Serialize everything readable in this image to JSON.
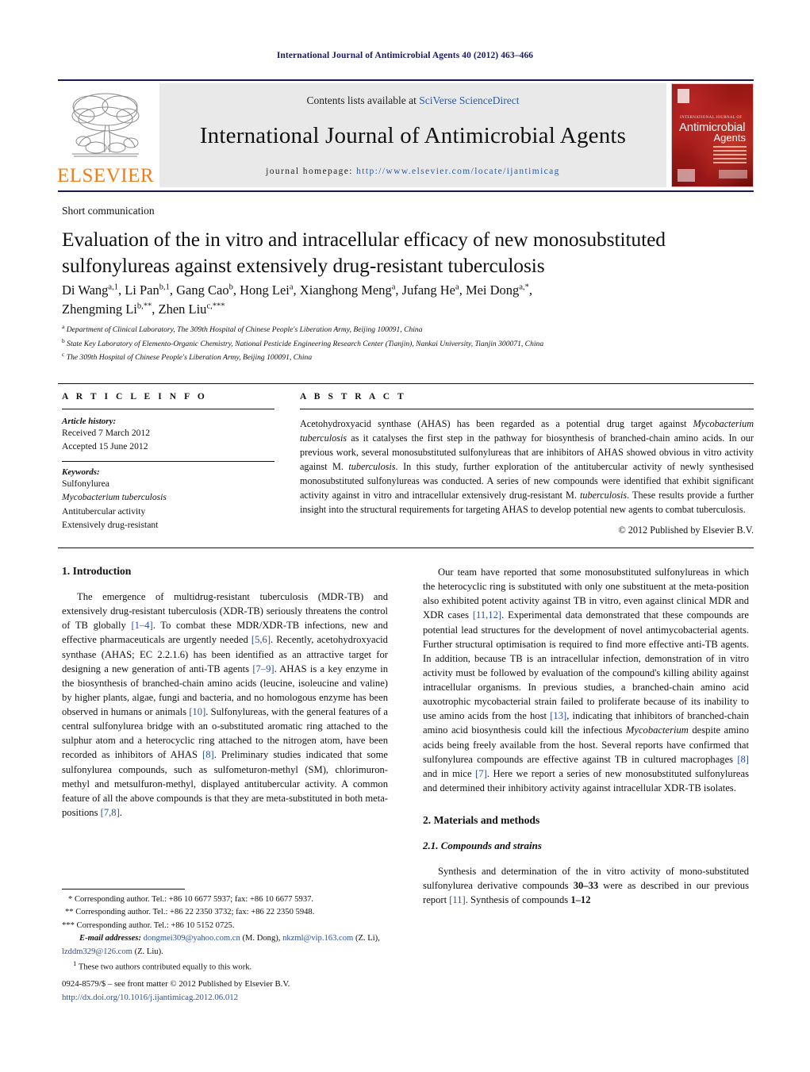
{
  "running_head": "International Journal of Antimicrobial Agents 40 (2012) 463–466",
  "masthead": {
    "publisher_logo_text": "ELSEVIER",
    "contents_prefix": "Contents lists available at ",
    "contents_link": "SciVerse ScienceDirect",
    "journal_title": "International Journal of Antimicrobial Agents",
    "homepage_prefix": "journal homepage: ",
    "homepage_url": "http://www.elsevier.com/locate/ijantimicag",
    "cover": {
      "kicker": "INTERNATIONAL JOURNAL OF",
      "title_line1": "Antimicrobial",
      "title_line2": "Agents"
    }
  },
  "article": {
    "type_label": "Short communication",
    "title": "Evaluation of the in vitro and intracellular efficacy of new monosubstituted sulfonylureas against extensively drug-resistant tuberculosis",
    "authors_line1": "Di Wang a,1, Li Pan b,1, Gang Cao b, Hong Lei a, Xianghong Meng a, Jufang He a, Mei Dong a,*,",
    "authors_line2": "Zhengming Li b,**, Zhen Liu c,***",
    "authors": [
      {
        "name": "Di Wang",
        "marks": "a,1"
      },
      {
        "name": "Li Pan",
        "marks": "b,1"
      },
      {
        "name": "Gang Cao",
        "marks": "b"
      },
      {
        "name": "Hong Lei",
        "marks": "a"
      },
      {
        "name": "Xianghong Meng",
        "marks": "a"
      },
      {
        "name": "Jufang He",
        "marks": "a"
      },
      {
        "name": "Mei Dong",
        "marks": "a,*"
      },
      {
        "name": "Zhengming Li",
        "marks": "b,**"
      },
      {
        "name": "Zhen Liu",
        "marks": "c,***"
      }
    ],
    "affiliations": [
      {
        "mark": "a",
        "text": "Department of Clinical Laboratory, The 309th Hospital of Chinese People's Liberation Army, Beijing 100091, China"
      },
      {
        "mark": "b",
        "text": "State Key Laboratory of Elemento-Organic Chemistry, National Pesticide Engineering Research Center (Tianjin), Nankai University, Tianjin 300071, China"
      },
      {
        "mark": "c",
        "text": "The 309th Hospital of Chinese People's Liberation Army, Beijing 100091, China"
      }
    ]
  },
  "article_info": {
    "heading": "A R T I C L E     I N F O",
    "history_label": "Article history:",
    "received": "Received 7 March 2012",
    "accepted": "Accepted 15 June 2012",
    "keywords_label": "Keywords:",
    "keywords": [
      "Sulfonylurea",
      "Mycobacterium tuberculosis",
      "Antitubercular activity",
      "Extensively drug-resistant"
    ]
  },
  "abstract": {
    "heading": "A B S T R A C T",
    "paragraph_1": "Acetohydroxyacid synthase (AHAS) has been regarded as a potential drug target against ",
    "italic_1": "Mycobacterium tuberculosis",
    "paragraph_2": " as it catalyses the first step in the pathway for biosynthesis of branched-chain amino acids. In our previous work, several monosubstituted sulfonylureas that are inhibitors of AHAS showed obvious in vitro activity against M. ",
    "italic_2": "tuberculosis",
    "paragraph_3": ". In this study, further exploration of the antitubercular activity of newly synthesised monosubstituted sulfonylureas was conducted. A series of new compounds were identified that exhibit significant activity against in vitro and intracellular extensively drug-resistant M. ",
    "italic_3": "tuberculosis",
    "paragraph_4": ". These results provide a further insight into the structural requirements for targeting AHAS to develop potential new agents to combat tuberculosis.",
    "copyright": "© 2012 Published by Elsevier B.V."
  },
  "body": {
    "intro_heading": "1.  Introduction",
    "intro_p1_a": "The emergence of multidrug-resistant tuberculosis (MDR-TB) and extensively drug-resistant tuberculosis (XDR-TB) seriously threatens the control of TB globally ",
    "intro_ref1": "[1–4]",
    "intro_p1_b": ". To combat these MDR/XDR-TB infections, new and effective pharmaceuticals are urgently needed ",
    "intro_ref2": "[5,6]",
    "intro_p1_c": ". Recently, acetohydroxyacid synthase (AHAS; EC 2.2.1.6) has been identified as an attractive target for designing a new generation of anti-TB agents ",
    "intro_ref3": "[7–9]",
    "intro_p1_d": ". AHAS is a key enzyme in the biosynthesis of branched-chain amino acids (leucine, isoleucine and valine) by higher plants, algae, fungi and bacteria, and no homologous enzyme has been observed in humans or animals ",
    "intro_ref4": "[10]",
    "intro_p1_e": ". Sulfonylureas, with the general features of a central sulfonylurea bridge with an o-substituted aromatic ring attached to the sulphur atom and a heterocyclic ring attached to the nitrogen atom, have been recorded as inhibitors of AHAS ",
    "intro_ref5": "[8]",
    "intro_p1_f": ". Preliminary studies indicated that some sulfonylurea compounds, such as sulfometuron-methyl (SM), chlorimuron-methyl and metsulfuron-methyl, displayed antitubercular activity. A common feature of all the above compounds is that they are meta-substituted in both meta-positions ",
    "intro_ref6": "[7,8]",
    "intro_p1_g": ".",
    "right_p1_a": "Our team have reported that some monosubstituted sulfonylureas in which the heterocyclic ring is substituted with only one substituent at the meta-position also exhibited potent activity against TB in vitro, even against clinical MDR and XDR cases ",
    "right_ref1": "[11,12]",
    "right_p1_b": ". Experimental data demonstrated that these compounds are potential lead structures for the development of novel antimycobacterial agents. Further structural optimisation is required to find more effective anti-TB agents. In addition, because TB is an intracellular infection, demonstration of in vitro activity must be followed by evaluation of the compound's killing ability against intracellular organisms. In previous studies, a branched-chain amino acid auxotrophic mycobacterial strain failed to proliferate because of its inability to use amino acids from the host ",
    "right_ref2": "[13]",
    "right_p1_c": ", indicating that inhibitors of branched-chain amino acid biosynthesis could kill the infectious ",
    "right_ital1": "Mycobacterium",
    "right_p1_d": " despite amino acids being freely available from the host. Several reports have confirmed that sulfonylurea compounds are effective against TB in cultured macrophages ",
    "right_ref3": "[8]",
    "right_p1_e": " and in mice ",
    "right_ref4": "[7]",
    "right_p1_f": ". Here we report a series of new monosubstituted sulfonylureas and determined their inhibitory activity against intracellular XDR-TB isolates.",
    "methods_heading": "2.  Materials and methods",
    "methods_sub": "2.1.  Compounds and strains",
    "methods_p1_a": "Synthesis and determination of the in vitro activity of mono-substituted sulfonylurea derivative compounds ",
    "methods_bold1": "30–33",
    "methods_p1_b": " were as described in our previous report ",
    "methods_ref1": "[11]",
    "methods_p1_c": ". Synthesis of compounds ",
    "methods_bold2": "1–12"
  },
  "footnotes": {
    "corr1": "* Corresponding author. Tel.: +86 10 6677 5937; fax: +86 10 6677 5937.",
    "corr2": "** Corresponding author. Tel.: +86 22 2350 3732; fax: +86 22 2350 5948.",
    "corr3": "*** Corresponding author. Tel.: +86 10 5152 0725.",
    "email_label": "E-mail addresses:",
    "email1": "dongmei309@yahoo.com.cn",
    "email1_owner": "(M. Dong)",
    "email2": "nkzml@vip.163.com",
    "email2_owner": "(Z. Li)",
    "email3": "lzddm329@126.com",
    "email3_owner": "(Z. Liu).",
    "equal_contrib": "These two authors contributed equally to this work.",
    "equal_mark": "1"
  },
  "imprint": {
    "issn_line": "0924-8579/$ – see front matter © 2012 Published by Elsevier B.V.",
    "doi": "http://dx.doi.org/10.1016/j.ijantimicag.2012.06.012"
  }
}
